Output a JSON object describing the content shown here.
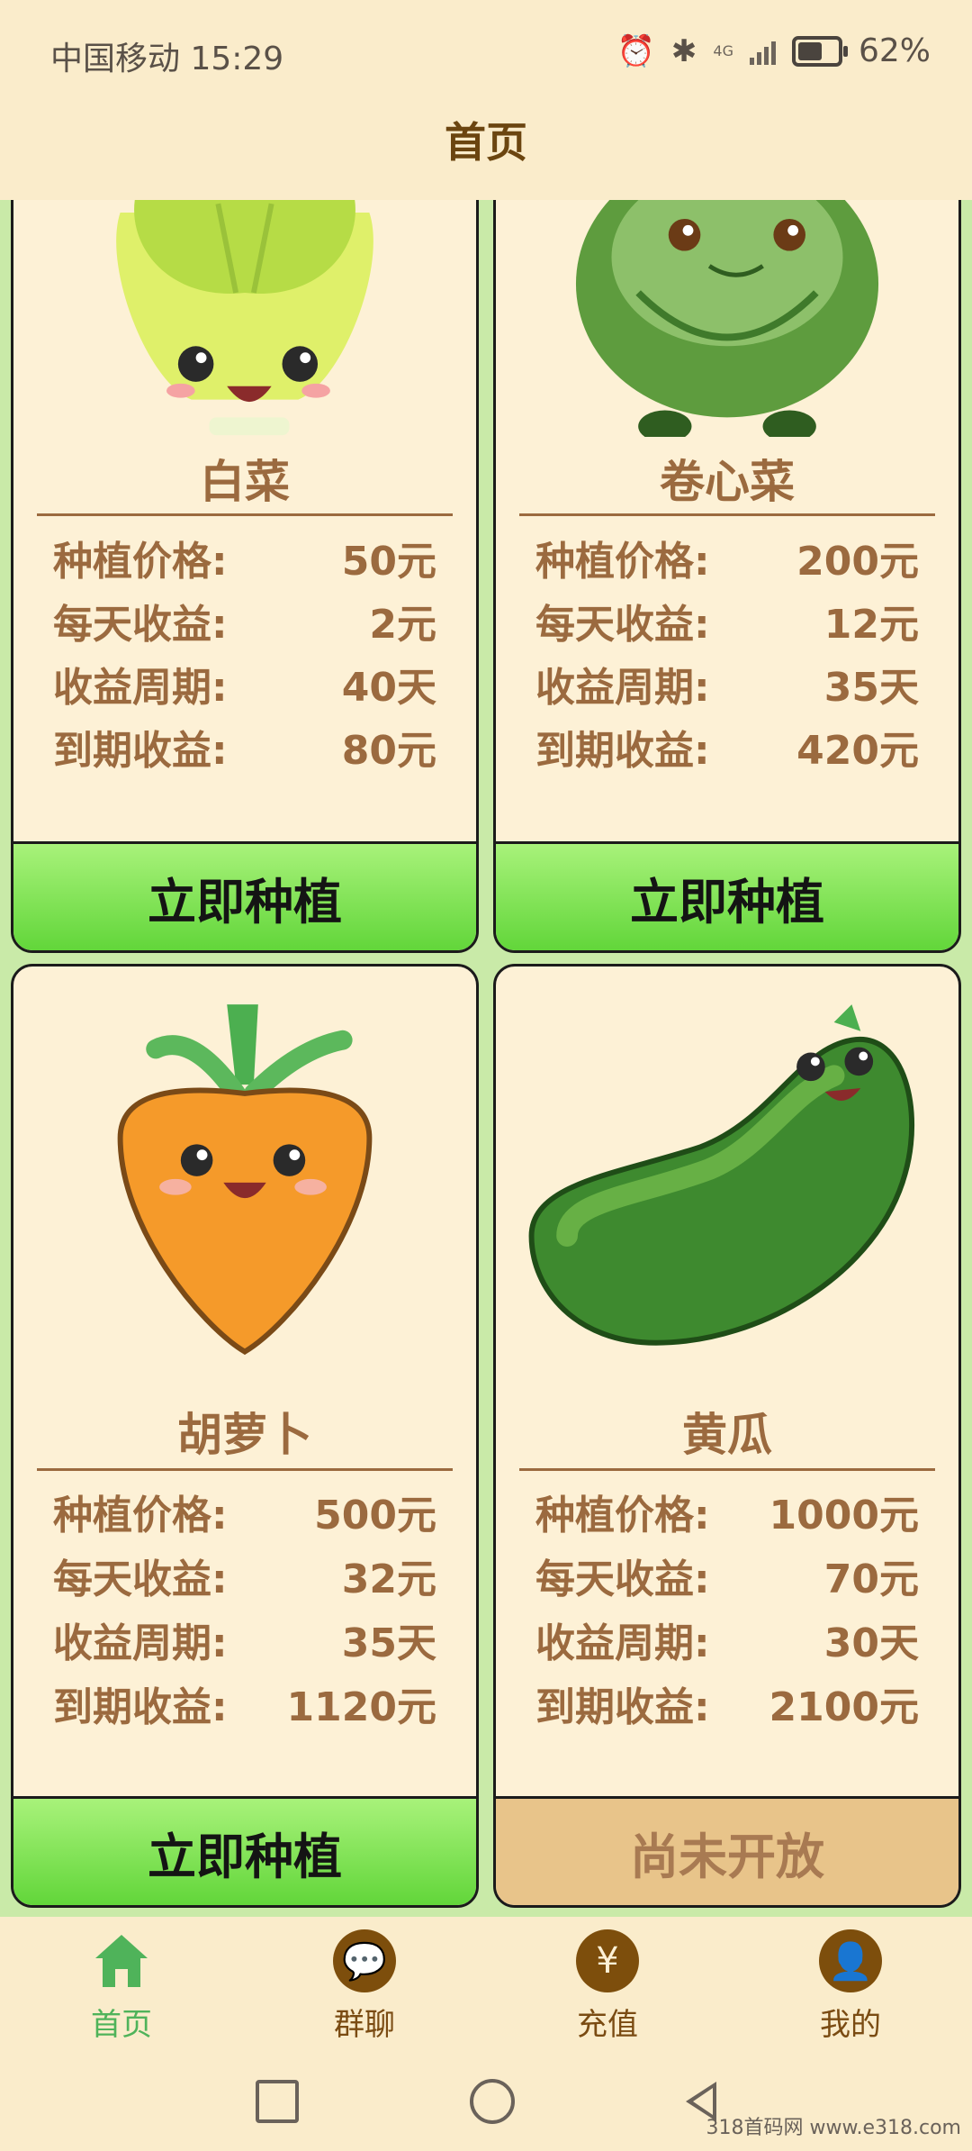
{
  "status_bar": {
    "carrier_time": "中国移动 15:29",
    "battery_percent": "62%",
    "net": "4G"
  },
  "header": {
    "title": "首页"
  },
  "cards": [
    {
      "name": "白菜",
      "rows": [
        {
          "label": "种植价格:",
          "value": "50元"
        },
        {
          "label": "每天收益:",
          "value": "2元"
        },
        {
          "label": "收益周期:",
          "value": "40天"
        },
        {
          "label": "到期收益:",
          "value": "80元"
        }
      ],
      "button": "立即种植",
      "button_state": "open",
      "art": "bok-choy-illustration"
    },
    {
      "name": "卷心菜",
      "rows": [
        {
          "label": "种植价格:",
          "value": "200元"
        },
        {
          "label": "每天收益:",
          "value": "12元"
        },
        {
          "label": "收益周期:",
          "value": "35天"
        },
        {
          "label": "到期收益:",
          "value": "420元"
        }
      ],
      "button": "立即种植",
      "button_state": "open",
      "art": "cabbage-illustration"
    },
    {
      "name": "胡萝卜",
      "rows": [
        {
          "label": "种植价格:",
          "value": "500元"
        },
        {
          "label": "每天收益:",
          "value": "32元"
        },
        {
          "label": "收益周期:",
          "value": "35天"
        },
        {
          "label": "到期收益:",
          "value": "1120元"
        }
      ],
      "button": "立即种植",
      "button_state": "open",
      "art": "carrot-illustration"
    },
    {
      "name": "黄瓜",
      "rows": [
        {
          "label": "种植价格:",
          "value": "1000元"
        },
        {
          "label": "每天收益:",
          "value": "70元"
        },
        {
          "label": "收益周期:",
          "value": "30天"
        },
        {
          "label": "到期收益:",
          "value": "2100元"
        }
      ],
      "button": "尚未开放",
      "button_state": "closed",
      "art": "cucumber-illustration"
    }
  ],
  "tabs": [
    {
      "label": "首页",
      "icon": "home-icon",
      "active": true
    },
    {
      "label": "群聊",
      "icon": "chat-icon",
      "active": false
    },
    {
      "label": "充值",
      "icon": "yuan-icon",
      "active": false
    },
    {
      "label": "我的",
      "icon": "profile-icon",
      "active": false
    }
  ],
  "watermark": "318首码网 www.e318.com",
  "colors": {
    "accent_green": "#62d63a",
    "brown_text": "#9b6a3f",
    "header_bg": "#faeccb",
    "card_bg": "#fdf1d6"
  }
}
